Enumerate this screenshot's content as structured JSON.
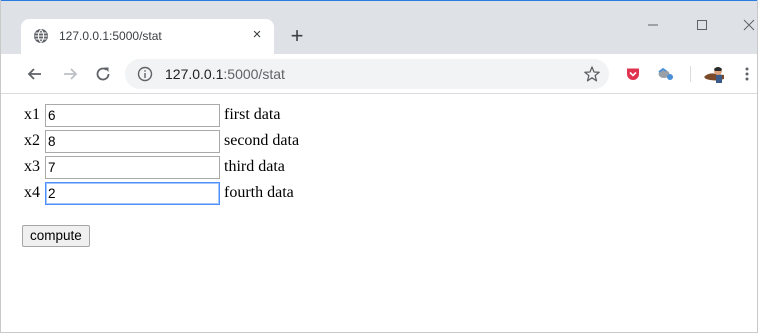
{
  "tab": {
    "title": "127.0.0.1:5000/stat",
    "close_glyph": "×",
    "new_tab_glyph": "+"
  },
  "address": {
    "host": "127.0.0.1",
    "path": ":5000/stat"
  },
  "form": {
    "rows": [
      {
        "label": "x1",
        "value": "6",
        "description": "first data"
      },
      {
        "label": "x2",
        "value": "8",
        "description": "second data"
      },
      {
        "label": "x3",
        "value": "7",
        "description": "third data"
      },
      {
        "label": "x4",
        "value": "2",
        "description": "fourth data"
      }
    ],
    "compute_label": "compute"
  },
  "icons": {
    "favicon": "globe-icon",
    "back": "back-arrow-icon",
    "forward": "forward-arrow-icon",
    "reload": "reload-icon",
    "info": "info-icon",
    "star": "bookmark-star-icon",
    "menu": "kebab-menu-icon"
  },
  "colors": {
    "tabstrip": "#dee1e6",
    "focus_border": "#4d90fe",
    "pocket": "#e0334f"
  }
}
